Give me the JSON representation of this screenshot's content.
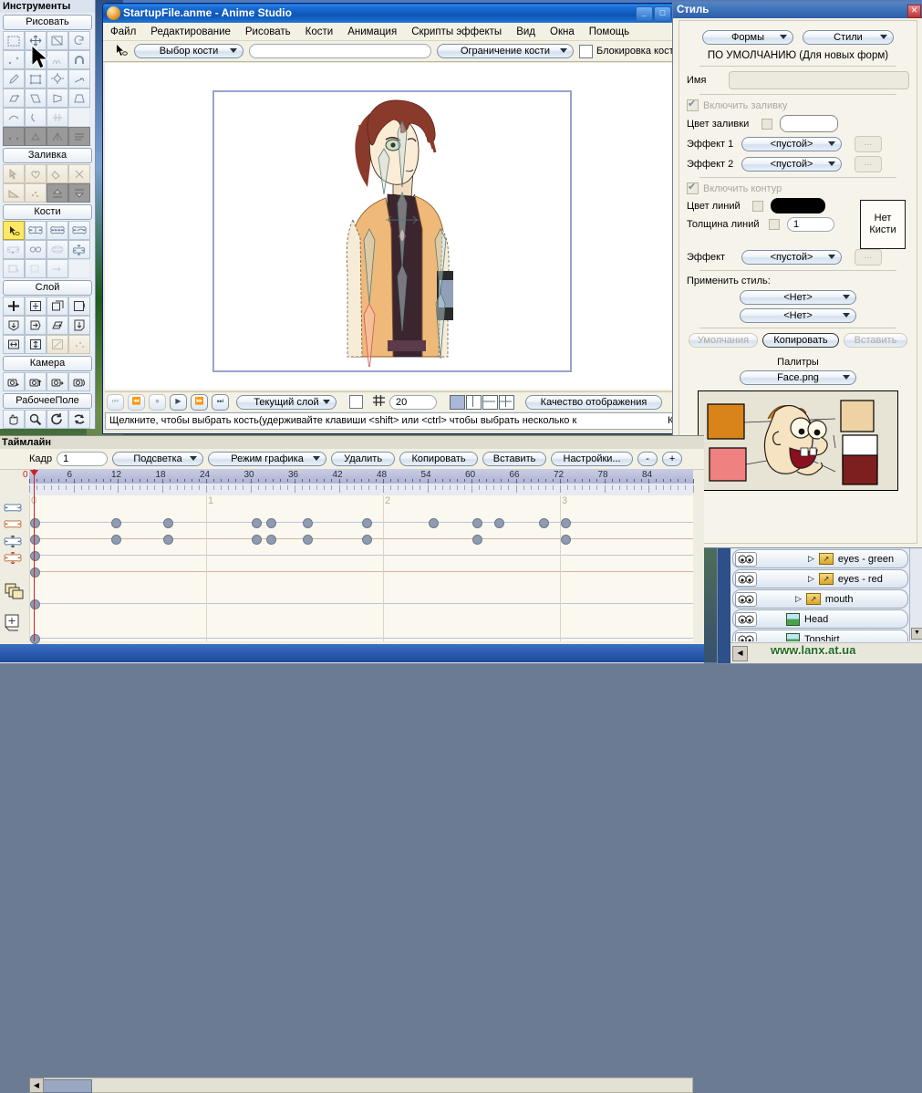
{
  "tools_panel": {
    "caption": "Инструменты",
    "groups": [
      {
        "title": "Рисовать",
        "icons": [
          "select-rect",
          "move-points",
          "scale-points",
          "rotate-points",
          "add-point",
          "curvature",
          "noise",
          "magnet",
          "draw-freehand",
          "draw-shape",
          "transform-shape",
          "delete-edge",
          "shear-points",
          "perspective-points",
          "bend-points",
          "width-tool",
          "curve-tool",
          "line-tool",
          "hatch-tool",
          "blank-tool",
          "sel-points-a",
          "sel-points-b",
          "sel-points-c",
          "sel-points-d"
        ]
      },
      {
        "title": "Заливка",
        "icons": [
          "select-shape",
          "create-shape",
          "paint-bucket",
          "delete-shape",
          "gradient",
          "scatter",
          "raise-shape",
          "lower-shape"
        ]
      },
      {
        "title": "Кости",
        "icons": [
          "select-bone",
          "translate-bone",
          "scale-bone",
          "rotate-bone",
          "add-bone",
          "bone-link",
          "bone-strength",
          "offset-bone",
          "bind-layer",
          "bind-points",
          "reparent-bone"
        ]
      },
      {
        "title": "Слой",
        "icons": [
          "add-layer",
          "translate-layer",
          "scale-layer",
          "rotate-layer-z",
          "rotate-layer-x",
          "rotate-layer-y",
          "shear-layer",
          "flip-layer",
          "set-origin",
          "follow-path",
          "layer-wide",
          "layer-tall"
        ]
      },
      {
        "title": "Камера",
        "icons": [
          "track-camera",
          "zoom-camera",
          "roll-camera",
          "pan-tilt-camera"
        ]
      },
      {
        "title": "РабочееПоле",
        "icons": [
          "pan-workspace",
          "zoom-workspace",
          "rotate-workspace",
          "reset-workspace"
        ]
      }
    ]
  },
  "app_window": {
    "title": "StartupFile.anme - Anime Studio",
    "minimize_label": "_",
    "maximize_label": "□",
    "menu": [
      "Файл",
      "Редактирование",
      "Рисовать",
      "Кости",
      "Анимация",
      "Скрипты эффекты",
      "Вид",
      "Окна",
      "Помощь"
    ],
    "tool_options": {
      "tool_icon": "select-bone-icon",
      "bone_select_label": "Выбор кости",
      "name_field_value": "",
      "bone_constraint_label": "Ограничение кости",
      "lock_bone_label": "Блокировка кости",
      "lock_bone_checked": false
    },
    "playback": {
      "buttons": [
        "⏮",
        "⏪",
        "⏹",
        "▶",
        "⏩",
        "⏭"
      ],
      "layer_select_label": "Текущий слой",
      "grid_value": "20",
      "quality_label": "Качество отображения"
    },
    "status_text": "Щелкните, чтобы выбрать кость(удерживайте клавиши <shift> или <ctrl> чтобы выбрать несколько к",
    "status_right": "Кад"
  },
  "style_panel": {
    "title": "Стиль",
    "close_label": "✕",
    "shapes_label": "Формы",
    "styles_label": "Стили",
    "default_header": "ПО УМОЛЧАНИЮ (Для новых форм)",
    "name_label": "Имя",
    "name_value": "",
    "fill_enable_label": "Включить заливку",
    "fill_enable_checked": true,
    "fill_color_label": "Цвет заливки",
    "fill_color": "#ffffff",
    "effect1_label": "Эффект 1",
    "effect1_value": "<пустой>",
    "effect2_label": "Эффект 2",
    "effect2_value": "<пустой>",
    "dots_label": "...",
    "outline_enable_label": "Включить контур",
    "outline_enable_checked": true,
    "line_color_label": "Цвет линий",
    "line_color": "#000000",
    "line_width_label": "Толщина линий",
    "line_width_value": "1",
    "brush_label_1": "Нет",
    "brush_label_2": "Кисти",
    "line_effect_label": "Эффект",
    "line_effect_value": "<пустой>",
    "apply_style_label": "Применить стиль:",
    "apply_style_1": "<Нет>",
    "apply_style_2": "<Нет>",
    "defaults_btn": "Умолчания",
    "copy_btn": "Копировать",
    "paste_btn": "Вставить",
    "palettes_label": "Палитры",
    "palette_file": "Face.png",
    "palette_swatches": [
      "#d9841b",
      "#eed2a4",
      "#ffffff",
      "#ef8181",
      "#7d1f1f"
    ]
  },
  "timeline": {
    "caption": "Таймлайн",
    "frame_label": "Кадр",
    "frame_value": "1",
    "highlight_label": "Подсветка",
    "graph_mode_label": "Режим графика",
    "delete_label": "Удалить",
    "copy_label": "Копировать",
    "paste_label": "Вставить",
    "settings_label": "Настройки...",
    "minus_label": "-",
    "plus_label": "+",
    "ruler_ticks": [
      "0",
      "6",
      "12",
      "18",
      "24",
      "30",
      "36",
      "42",
      "48",
      "54",
      "60",
      "66",
      "72",
      "78",
      "84"
    ],
    "second_markers": [
      "0",
      "1",
      "2",
      "3"
    ],
    "channel_icons": [
      "bone-blue",
      "bone-red",
      "bone-scale-blue",
      "bone-scale-red",
      "layers-stack",
      "layer-transform"
    ],
    "keyframes": {
      "row1": [
        0,
        11,
        18,
        30,
        32,
        37,
        45,
        54,
        60,
        63,
        69,
        72
      ],
      "row2": [
        0,
        11,
        18,
        30,
        32,
        37,
        45,
        60,
        72
      ],
      "row3": [
        0
      ],
      "row4": [
        0
      ],
      "row5": [
        0
      ],
      "row6": [
        0
      ]
    }
  },
  "layers_panel": {
    "rows": [
      {
        "name": "eyes - green",
        "type": "group",
        "expander": "▷"
      },
      {
        "name": "eyes - red",
        "type": "group",
        "expander": "▷"
      },
      {
        "name": "mouth",
        "type": "group",
        "expander": "▷"
      },
      {
        "name": "Head",
        "type": "image",
        "expander": ""
      },
      {
        "name": "Topshirt",
        "type": "image",
        "expander": ""
      }
    ]
  },
  "watermark": "www.lanx.at.ua"
}
